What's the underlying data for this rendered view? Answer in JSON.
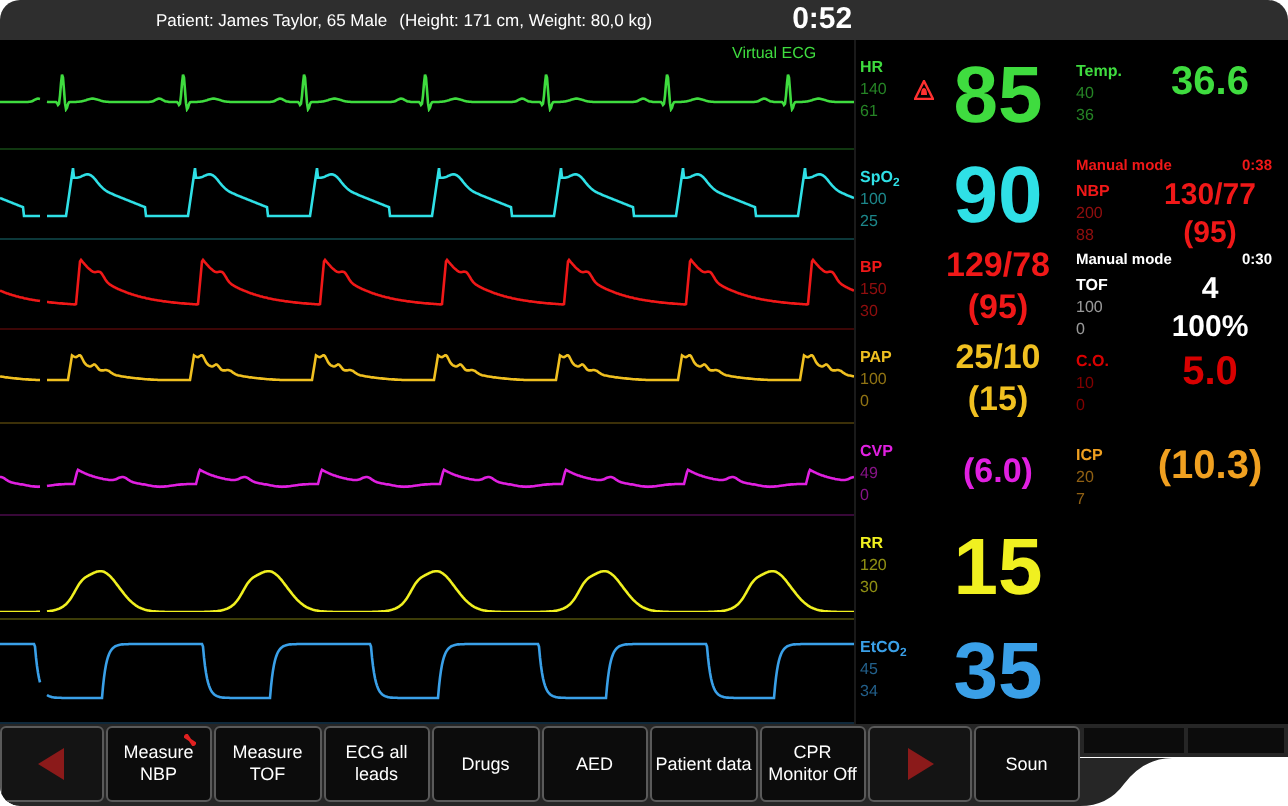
{
  "header": {
    "patient": "Patient: James Taylor, 65 Male",
    "measurements": "(Height: 171 cm, Weight: 80,0 kg)",
    "timer": "0:52"
  },
  "waveform_title": "Virtual ECG",
  "channels": [
    {
      "kind": "ecg",
      "label": "HR",
      "high": "140",
      "low": "61",
      "values": [
        "85"
      ],
      "color": "#3fdc3f",
      "alarm": true
    },
    {
      "kind": "pleth",
      "label": "SpO$_{2}$",
      "high": "100",
      "low": "25",
      "values": [
        "90"
      ],
      "color": "#2fe0e6",
      "alarm": false
    },
    {
      "kind": "art",
      "label": "BP",
      "high": "150",
      "low": "30",
      "values": [
        "129/78",
        "(95)"
      ],
      "color": "#f01818",
      "alarm": false
    },
    {
      "kind": "pap",
      "label": "PAP",
      "high": "100",
      "low": "0",
      "values": [
        "25/10",
        "(15)"
      ],
      "color": "#f0c020",
      "alarm": false
    },
    {
      "kind": "cvp",
      "label": "CVP",
      "high": "49",
      "low": "0",
      "values": [
        "(6.0)"
      ],
      "color": "#e020e0",
      "alarm": false
    },
    {
      "kind": "resp",
      "label": "RR",
      "high": "120",
      "low": "30",
      "values": [
        "15"
      ],
      "color": "#f0f020",
      "alarm": false
    },
    {
      "kind": "capno",
      "label": "EtCO$_{2}$",
      "high": "45",
      "low": "34",
      "values": [
        "35"
      ],
      "color": "#3aa0e8",
      "alarm": false
    }
  ],
  "side_parameters": [
    {
      "label": "Temp.",
      "high": "40",
      "low": "36",
      "values": [
        "36.6"
      ],
      "color": "#3fdc3f"
    },
    {
      "mode": "Manual mode",
      "time": "0:38",
      "label": "NBP",
      "high": "200",
      "low": "88",
      "values": [
        "130/77",
        "(95)"
      ],
      "color": "#f01818"
    },
    {
      "mode": "Manual mode",
      "time": "0:30",
      "label": "TOF",
      "high": "100",
      "low": "0",
      "values": [
        "4",
        "100%"
      ],
      "color": "#ffffff"
    },
    {
      "label": "C.O.",
      "high": "10",
      "low": "0",
      "values": [
        "5.0"
      ],
      "color": "#d80000"
    },
    {
      "label": "ICP",
      "high": "20",
      "low": "7",
      "values": [
        "(10.3)"
      ],
      "color": "#f0a020"
    }
  ],
  "buttons": [
    {
      "kind": "arrow-left"
    },
    {
      "kind": "text",
      "label": "Measure NBP",
      "indicator": true
    },
    {
      "kind": "text",
      "label": "Measure TOF",
      "indicator": false
    },
    {
      "kind": "text",
      "label": "ECG all leads",
      "indicator": false
    },
    {
      "kind": "text",
      "label": "Drugs",
      "indicator": false
    },
    {
      "kind": "text",
      "label": "AED",
      "indicator": false
    },
    {
      "kind": "text",
      "label": "Patient data",
      "indicator": false
    },
    {
      "kind": "text",
      "label": "CPR Monitor Off",
      "indicator": false
    },
    {
      "kind": "arrow-right"
    },
    {
      "kind": "text",
      "label": "Soun",
      "indicator": false
    },
    {
      "kind": "blank"
    },
    {
      "kind": "blank"
    }
  ]
}
